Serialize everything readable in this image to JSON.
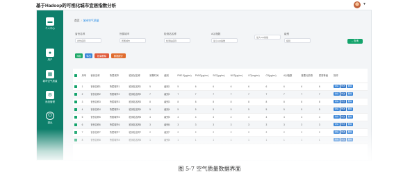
{
  "app": {
    "title": "基于Hadoop的可视化城市宜居指数分析"
  },
  "sidebar": {
    "items": [
      {
        "label": "个人中心",
        "icon": "user-icon"
      },
      {
        "label": "用户",
        "icon": "person-icon"
      },
      {
        "label": "城市空气质量",
        "icon": "grid-icon"
      },
      {
        "label": "系统管理",
        "icon": "settings-icon"
      },
      {
        "label": "退出",
        "icon": "power-icon"
      }
    ]
  },
  "breadcrumb": {
    "home": "首页",
    "current": "城市空气质量"
  },
  "filters": [
    {
      "label": "省份名称",
      "placeholder": "省份名称"
    },
    {
      "label": "所属城市",
      "placeholder": "所属城市"
    },
    {
      "label": "检测站名称",
      "placeholder": "检测站名称"
    },
    {
      "label": "AQI指数",
      "placeholder": "最小AQI指数"
    },
    {
      "label": "",
      "placeholder": "最大AQI指数"
    },
    {
      "label": "级别",
      "placeholder": "级别"
    }
  ],
  "search_button": {
    "label": "查询"
  },
  "actions": {
    "add": "添加",
    "export": "导出",
    "batch_delete": "批量删除",
    "statistics": "数据统计"
  },
  "table": {
    "headers": [
      "",
      "序号",
      "省份名称",
      "所属城市",
      "检测站名称",
      "采集时间",
      "级别",
      "PM2.5(μg/m³)",
      "PM10(μg/m³)",
      "SO2(μg/m³)",
      "NO2(μg/m³)",
      "CO(mg/m³)",
      "O3(μg/m³)",
      "AQI指数",
      "首要污染物",
      "质量等级",
      "操作"
    ],
    "rows": [
      [
        "",
        "1",
        "省份名称1",
        "所属城市1",
        "检测站名称1",
        "5",
        "级别1",
        "5",
        "6",
        "6",
        "6",
        "6",
        "6",
        "6",
        "6",
        "6",
        ""
      ],
      [
        "",
        "2",
        "省份名称2",
        "所属城市2",
        "检测站名称2",
        "7",
        "级别2",
        "7",
        "7",
        "7",
        "7",
        "7",
        "7",
        "7",
        "7",
        "7",
        ""
      ],
      [
        "",
        "3",
        "省份名称3",
        "所属城市3",
        "检测站名称3",
        "8",
        "级别3",
        "8",
        "8",
        "8",
        "8",
        "8",
        "8",
        "8",
        "8",
        "8",
        ""
      ],
      [
        "",
        "4",
        "省份名称4",
        "所属城市4",
        "检测站名称4",
        "5",
        "级别4",
        "5",
        "5",
        "5",
        "5",
        "5",
        "5",
        "5",
        "5",
        "5",
        ""
      ],
      [
        "",
        "5",
        "省份名称5",
        "所属城市5",
        "检测站名称5",
        "4",
        "级别5",
        "4",
        "4",
        "4",
        "4",
        "4",
        "4",
        "4",
        "4",
        "4",
        ""
      ],
      [
        "",
        "6",
        "省份名称6",
        "所属城市6",
        "检测站名称6",
        "3",
        "级别6",
        "3",
        "3",
        "3",
        "3",
        "3",
        "3",
        "3",
        "3",
        "3",
        ""
      ],
      [
        "",
        "7",
        "省份名称7",
        "所属城市7",
        "检测站名称7",
        "2",
        "级别7",
        "2",
        "2",
        "2",
        "2",
        "2",
        "2",
        "2",
        "2",
        "2",
        ""
      ],
      [
        "",
        "8",
        "省份名称8",
        "所属城市8",
        "检测站名称8",
        "1",
        "级别8",
        "1",
        "1",
        "1",
        "1",
        "1",
        "1",
        "1",
        "1",
        "1",
        ""
      ]
    ],
    "row_actions": {
      "detail": "详情",
      "modify": "修改",
      "delete": "删除"
    }
  },
  "caption": "图 5-7 空气质量数据界面",
  "colors": {
    "sidebar": "#0e7f6b",
    "primary": "#13a36b",
    "blue": "#3b86d8",
    "red": "#e05a3b"
  }
}
